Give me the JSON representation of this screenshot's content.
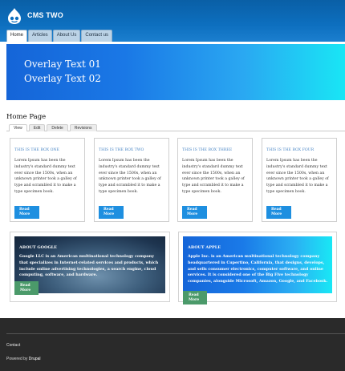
{
  "site": {
    "name": "CMS TWO",
    "logo_icon": "drupal-drop-icon"
  },
  "nav": {
    "tabs": [
      {
        "label": "Home",
        "active": true
      },
      {
        "label": "Articles",
        "active": false
      },
      {
        "label": "About Us",
        "active": false
      },
      {
        "label": "Contact us",
        "active": false
      }
    ]
  },
  "banner": {
    "line1": "Overlay Text 01",
    "line2": "Overlay Text 02"
  },
  "page": {
    "title": "Home Page",
    "local_tabs": [
      {
        "label": "View",
        "active": true
      },
      {
        "label": "Edit",
        "active": false
      },
      {
        "label": "Delete",
        "active": false
      },
      {
        "label": "Revisions",
        "active": false
      }
    ]
  },
  "boxes": [
    {
      "title": "THIS IS THE BOX ONE",
      "body": "Lorem Ipsum has been the industry's standard dummy text ever since the 1500s, when an unknown printer took a galley of type and scrambled it to make a type specimen book.",
      "readmore": "Read More"
    },
    {
      "title": "THIS IS THE BOX TWO",
      "body": "Lorem Ipsum has been the industry's standard dummy text ever since the 1500s, when an unknown printer took a galley of type and scrambled it to make a type specimen book.",
      "readmore": "Read More"
    },
    {
      "title": "THIS IS THE BOX THREE",
      "body": "Lorem Ipsum has been the industry's standard dummy text ever since the 1500s, when an unknown printer took a galley of type and scrambled it to make a type specimen book.",
      "readmore": "Read More"
    },
    {
      "title": "THIS IS THE BOX FOUR",
      "body": "Lorem Ipsum has been the industry's standard dummy text ever since the 1500s, when an unknown printer took a galley of type and scrambled it to make a type specimen book.",
      "readmore": "Read More"
    }
  ],
  "features": [
    {
      "title": "ABOUT GOOGLE",
      "body": "Google LLC is an American multinational technology company that specializes in Internet-related services and products, which include online advertising technologies, a search engine, cloud computing, software, and hardware.",
      "readmore": "Read More"
    },
    {
      "title": "ABOUT APPLE",
      "body": "Apple Inc. is an American multinational technology company headquartered in Cupertino, California, that designs, develops, and sells consumer electronics, computer software, and online services. It is considered one of the Big Five technology companies, alongside Microsoft, Amazon, Google, and Facebook.",
      "readmore": "Read More"
    }
  ],
  "footer": {
    "contact": "Contact",
    "powered_prefix": "Powered by",
    "powered_link": "Drupal"
  },
  "colors": {
    "header": "#0d6fbf",
    "accent_blue": "#1e8fe0",
    "readmore_green": "#4b9a6a",
    "footer_bg": "#2a2a2a"
  }
}
